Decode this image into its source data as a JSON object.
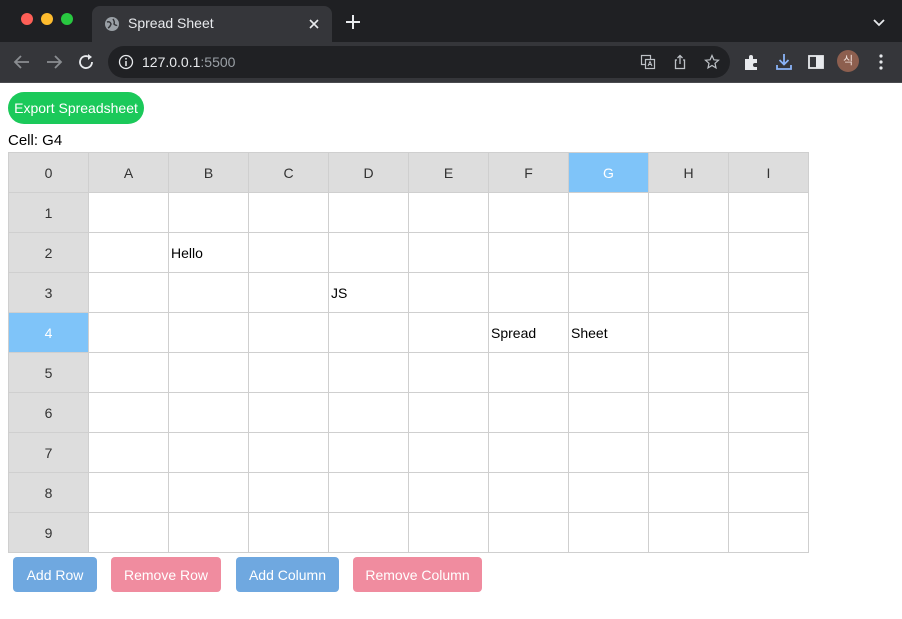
{
  "browser": {
    "tab_title": "Spread Sheet",
    "url_host": "127.0.0.1",
    "url_port": ":5500",
    "profile_initial": "식"
  },
  "page": {
    "export_label": "Export Spreadsheet",
    "cell_label": "Cell: G4",
    "selected_column": "G",
    "selected_row": "4",
    "corner": "0",
    "columns": [
      "A",
      "B",
      "C",
      "D",
      "E",
      "F",
      "G",
      "H",
      "I"
    ],
    "rows": [
      {
        "label": "1",
        "cells": [
          "",
          "",
          "",
          "",
          "",
          "",
          "",
          "",
          ""
        ]
      },
      {
        "label": "2",
        "cells": [
          "",
          "Hello",
          "",
          "",
          "",
          "",
          "",
          "",
          ""
        ]
      },
      {
        "label": "3",
        "cells": [
          "",
          "",
          "",
          "JS",
          "",
          "",
          "",
          "",
          ""
        ]
      },
      {
        "label": "4",
        "cells": [
          "",
          "",
          "",
          "",
          "",
          "Spread",
          "Sheet",
          "",
          ""
        ]
      },
      {
        "label": "5",
        "cells": [
          "",
          "",
          "",
          "",
          "",
          "",
          "",
          "",
          ""
        ]
      },
      {
        "label": "6",
        "cells": [
          "",
          "",
          "",
          "",
          "",
          "",
          "",
          "",
          ""
        ]
      },
      {
        "label": "7",
        "cells": [
          "",
          "",
          "",
          "",
          "",
          "",
          "",
          "",
          ""
        ]
      },
      {
        "label": "8",
        "cells": [
          "",
          "",
          "",
          "",
          "",
          "",
          "",
          "",
          ""
        ]
      },
      {
        "label": "9",
        "cells": [
          "",
          "",
          "",
          "",
          "",
          "",
          "",
          "",
          ""
        ]
      }
    ],
    "buttons": {
      "add_row": "Add Row",
      "remove_row": "Remove Row",
      "add_column": "Add Column",
      "remove_column": "Remove Column"
    }
  },
  "colors": {
    "header_bg": "#dddddd",
    "selected_header": "#7fc4f9",
    "export_green": "#1bc95a",
    "add_blue": "#6fa8e0",
    "remove_pink": "#f08c9f"
  },
  "icons": {
    "favicon": "globe-icon",
    "back": "back-arrow-icon",
    "forward": "forward-arrow-icon",
    "reload": "reload-icon",
    "site_info": "info-icon",
    "translate": "translate-icon",
    "share": "share-icon",
    "bookmark": "star-icon",
    "extensions": "puzzle-icon",
    "downloads": "download-icon",
    "side_panel": "side-panel-icon",
    "menu": "kebab-menu-icon"
  }
}
